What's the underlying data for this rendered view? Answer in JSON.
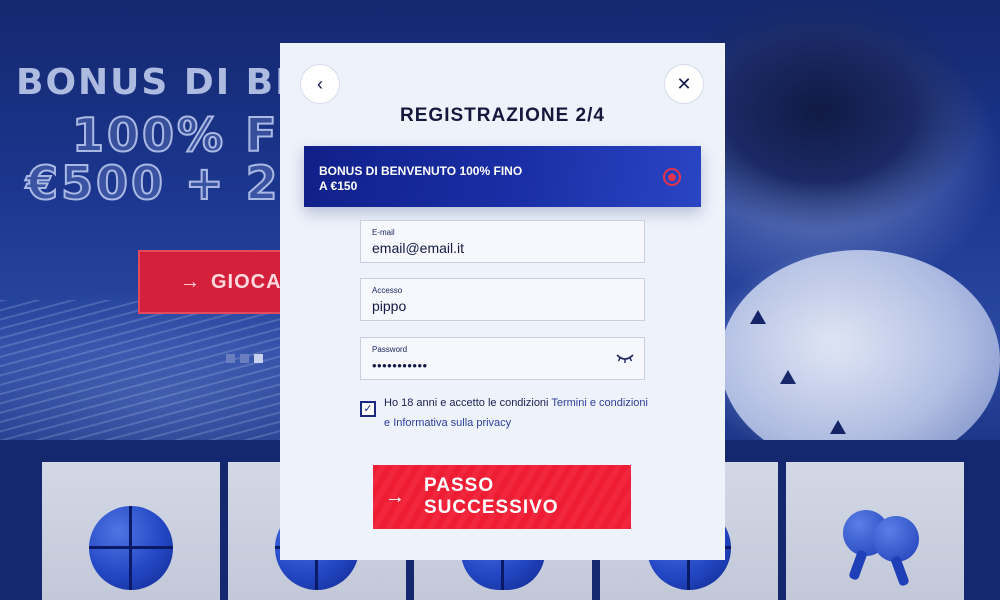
{
  "hero": {
    "title": "BONUS DI BE",
    "line2": "100% FI",
    "line3": "€500 + 2",
    "cta_label": "GIOCA O",
    "cta_icon": "arrow-right-icon",
    "carousel": {
      "count": 3,
      "active_index": 2
    }
  },
  "categories": [
    {
      "icon": "basketball-icon"
    },
    {
      "icon": "football-icon"
    },
    {
      "icon": "rugby-ball-icon"
    },
    {
      "icon": "volleyball-icon"
    },
    {
      "icon": "table-tennis-icon"
    }
  ],
  "modal": {
    "title": "REGISTRAZIONE 2/4",
    "back_icon": "chevron-left-icon",
    "back_glyph": "‹",
    "close_icon": "close-icon",
    "close_glyph": "✕",
    "bonus": {
      "text": "BONUS DI BENVENUTO 100% FINO A €150",
      "icon": "football-icon",
      "icon_color": "#e8334b"
    },
    "fields": {
      "email": {
        "label": "E-mail",
        "value": "email@email.it"
      },
      "username": {
        "label": "Accesso",
        "value": "pippo"
      },
      "password": {
        "label": "Password",
        "value": "•••••••••••",
        "toggle_icon": "eye-closed-icon"
      }
    },
    "terms": {
      "checked": true,
      "check_glyph": "✓",
      "text_prefix": "Ho 18 anni e accetto le condizioni",
      "link1": "Termini e condizioni",
      "joiner": "e",
      "link2": "Informativa sulla privacy"
    },
    "next_button": {
      "label": "PASSO SUCCESSIVO",
      "icon": "arrow-right-icon",
      "glyph": "→"
    }
  },
  "colors": {
    "accent_red": "#ee1d33",
    "brand_navy": "#10208a",
    "text_dark": "#14183d"
  }
}
